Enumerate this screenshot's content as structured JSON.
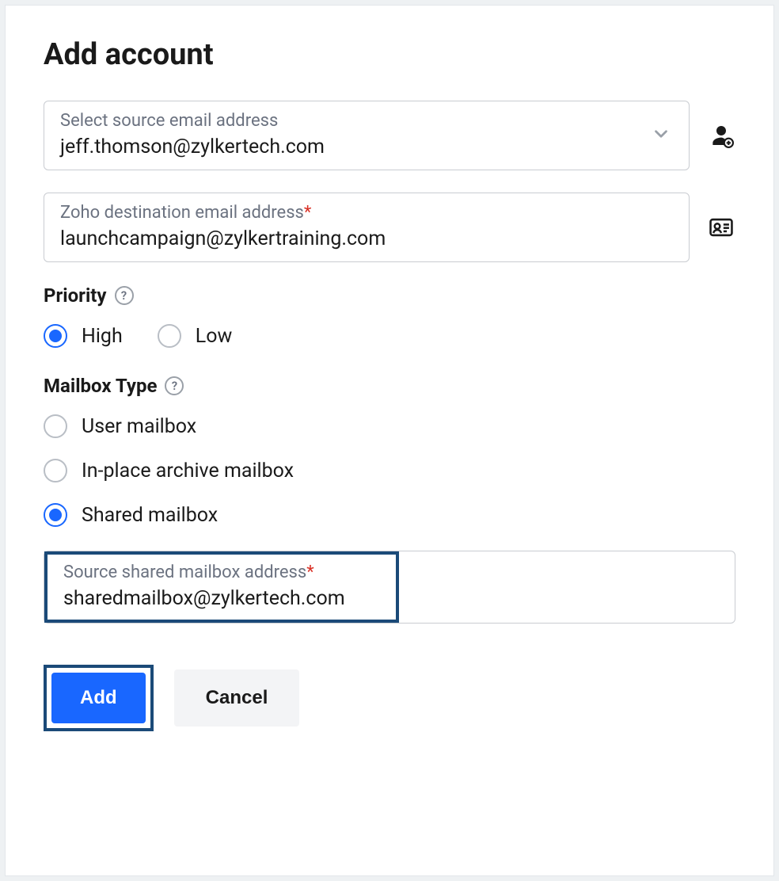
{
  "title": "Add account",
  "source": {
    "label": "Select source email address",
    "value": "jeff.thomson@zylkertech.com"
  },
  "destination": {
    "label": "Zoho destination email address",
    "required": "*",
    "value": "launchcampaign@zylkertraining.com"
  },
  "priority": {
    "label": "Priority",
    "options": {
      "high": "High",
      "low": "Low"
    },
    "selected": "high"
  },
  "mailbox_type": {
    "label": "Mailbox Type",
    "options": {
      "user": "User mailbox",
      "archive": "In-place archive mailbox",
      "shared": "Shared mailbox"
    },
    "selected": "shared"
  },
  "shared": {
    "label": "Source shared mailbox address",
    "required": "*",
    "value": "sharedmailbox@zylkertech.com"
  },
  "buttons": {
    "add": "Add",
    "cancel": "Cancel"
  }
}
